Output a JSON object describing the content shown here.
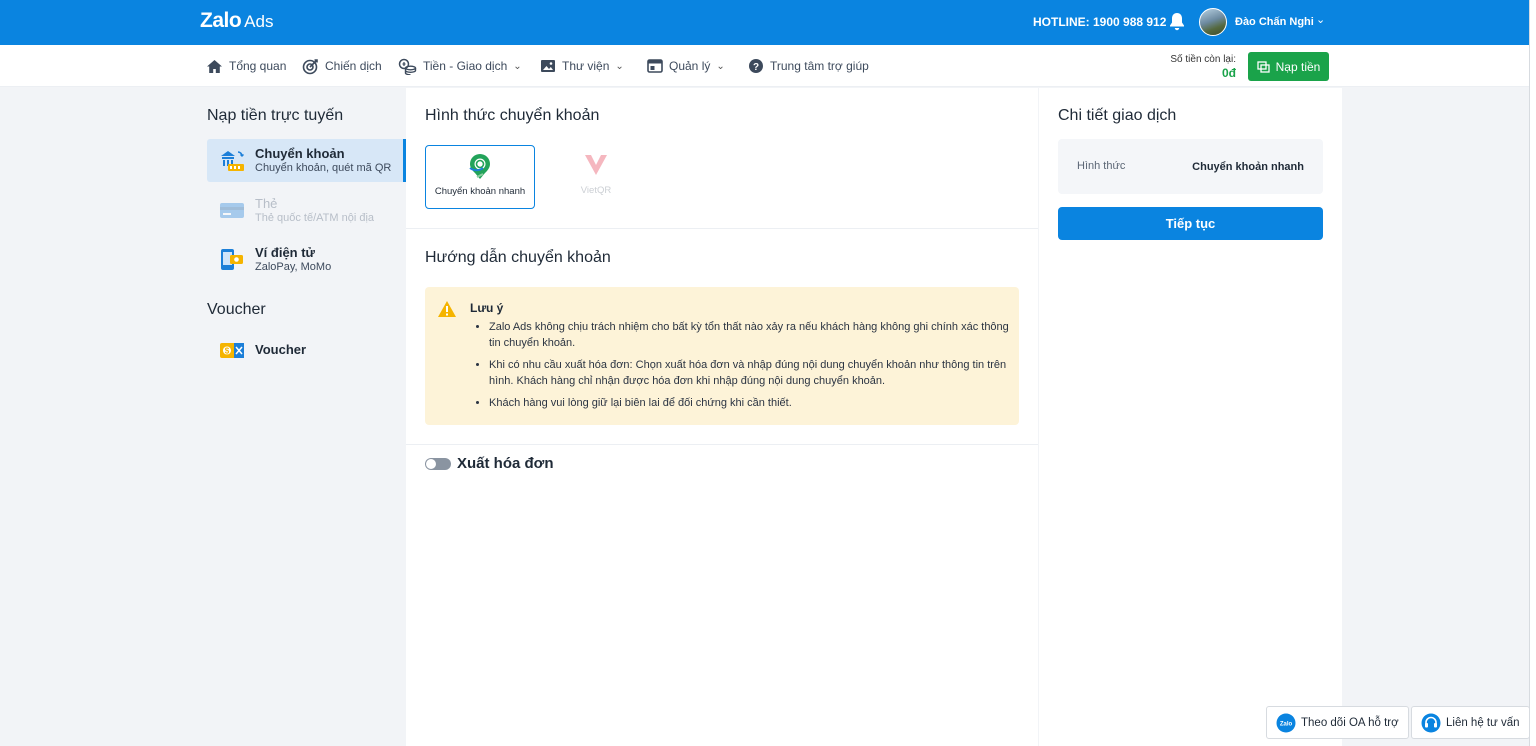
{
  "header": {
    "logo_main": "Zalo",
    "logo_sub": "Ads",
    "hotline": "HOTLINE: 1900 988 912",
    "username": "Đào Chấn Nghi"
  },
  "nav": {
    "items": [
      {
        "label": "Tổng quan",
        "icon": "home-icon"
      },
      {
        "label": "Chiến dịch",
        "icon": "target-icon"
      },
      {
        "label": "Tiền - Giao dịch",
        "icon": "coins-icon",
        "dropdown": true
      },
      {
        "label": "Thư viện",
        "icon": "image-icon",
        "dropdown": true
      },
      {
        "label": "Quản lý",
        "icon": "window-icon",
        "dropdown": true
      },
      {
        "label": "Trung tâm trợ giúp",
        "icon": "help-icon"
      }
    ],
    "balance_label": "Số tiền còn lại:",
    "balance_value": "0đ",
    "topup_label": "Nạp tiền"
  },
  "sidebar": {
    "title": "Nạp tiền trực tuyến",
    "items": [
      {
        "title": "Chuyển khoản",
        "subtitle": "Chuyển khoản, quét mã QR",
        "state": "active"
      },
      {
        "title": "Thẻ",
        "subtitle": "Thẻ quốc tế/ATM nội địa",
        "state": "disabled"
      },
      {
        "title": "Ví điện tử",
        "subtitle": "ZaloPay, MoMo",
        "state": "normal"
      }
    ],
    "voucher_title": "Voucher",
    "voucher_item": "Voucher"
  },
  "main": {
    "method_title": "Hình thức chuyển khoản",
    "methods": [
      {
        "label": "Chuyển khoản nhanh",
        "selected": true
      },
      {
        "label": "VietQR",
        "selected": false
      }
    ],
    "guide_title": "Hướng dẫn chuyển khoản",
    "notice": {
      "title": "Lưu ý",
      "items": [
        "Zalo Ads không chịu trách nhiệm cho bất kỳ tổn thất nào xảy ra nếu khách hàng không ghi chính xác thông tin chuyển khoản.",
        "Khi có nhu cầu xuất hóa đơn: Chọn xuất hóa đơn và nhập đúng nội dung chuyển khoản như thông tin trên hình. Khách hàng chỉ nhận được hóa đơn khi nhập đúng nội dung chuyển khoản.",
        "Khách hàng vui lòng giữ lại biên lai để đối chứng khi cần thiết."
      ]
    },
    "invoice_toggle_label": "Xuất hóa đơn",
    "invoice_toggle_on": false
  },
  "details": {
    "title": "Chi tiết giao dịch",
    "row_key": "Hình thức",
    "row_value": "Chuyển khoản nhanh",
    "continue_label": "Tiếp tục"
  },
  "support": {
    "follow_oa": "Theo dõi OA hỗ trợ",
    "contact": "Liên hệ tư vấn",
    "zalo_badge": "Zalo"
  },
  "colors": {
    "primary": "#0a84e0",
    "success": "#1aa34a",
    "notice_bg": "#fdf3d8",
    "warning": "#f5b400"
  }
}
